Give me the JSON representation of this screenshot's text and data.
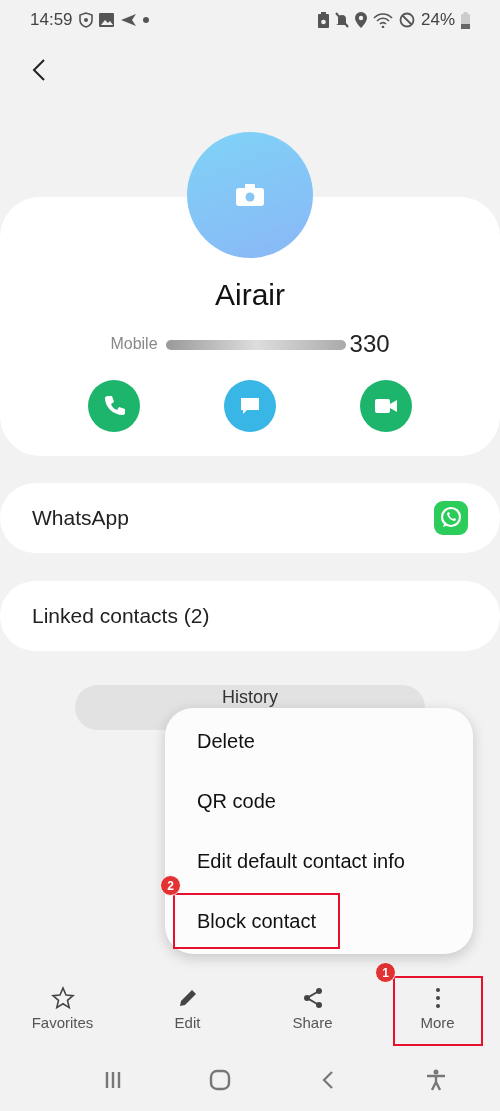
{
  "status_bar": {
    "time": "14:59",
    "battery": "24%"
  },
  "contact": {
    "name": "Airair",
    "phone_label": "Mobile",
    "phone_number": "330"
  },
  "actions": [
    {
      "kind": "call",
      "color": "#1db56c"
    },
    {
      "kind": "message",
      "color": "#38b6e6"
    },
    {
      "kind": "video",
      "color": "#1db56c"
    }
  ],
  "apps": [
    {
      "label": "WhatsApp",
      "kind": "whatsapp"
    },
    {
      "label": "Linked contacts (2)",
      "kind": "plain"
    }
  ],
  "history_button": {
    "label": "History"
  },
  "menu": {
    "items": [
      {
        "label": "Delete",
        "highlighted": false
      },
      {
        "label": "QR code",
        "highlighted": false
      },
      {
        "label": "Edit default contact info",
        "highlighted": false
      },
      {
        "label": "Block contact",
        "highlighted": true,
        "badge": "2"
      }
    ]
  },
  "toolbar": [
    {
      "label": "Favorites",
      "kind": "star",
      "highlighted": false
    },
    {
      "label": "Edit",
      "kind": "pencil",
      "highlighted": false
    },
    {
      "label": "Share",
      "kind": "share",
      "highlighted": false
    },
    {
      "label": "More",
      "kind": "more",
      "highlighted": true,
      "badge": "1"
    }
  ]
}
